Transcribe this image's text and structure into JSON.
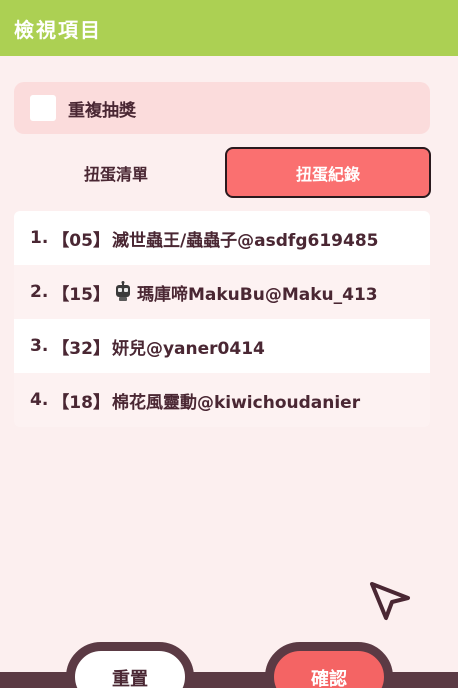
{
  "header": {
    "title": "檢視項目"
  },
  "repeat": {
    "label": "重複抽獎",
    "checked": false
  },
  "tabs": [
    {
      "label": "扭蛋清單",
      "active": false
    },
    {
      "label": "扭蛋紀錄",
      "active": true
    }
  ],
  "records": [
    {
      "index": "1.",
      "code": "【05】",
      "avatar": false,
      "name": "滅世蟲王/蟲蟲子@asdfg619485"
    },
    {
      "index": "2.",
      "code": "【15】",
      "avatar": true,
      "name": "瑪庫啼MakuBu@Maku_413"
    },
    {
      "index": "3.",
      "code": "【32】",
      "avatar": false,
      "name": "妍兒@yaner0414"
    },
    {
      "index": "4.",
      "code": "【18】",
      "avatar": false,
      "name": "棉花風靈動@kiwichoudanier"
    }
  ],
  "buttons": {
    "reset_label": "重置",
    "confirm_label": "確認"
  },
  "colors": {
    "header": "#acd053",
    "accent": "#fa7070",
    "background": "#fcefef",
    "text": "#4a2733",
    "dark": "#5b3a44"
  },
  "icons": {
    "avatar": "robot-avatar-icon",
    "cursor": "pointer-cursor-icon"
  }
}
